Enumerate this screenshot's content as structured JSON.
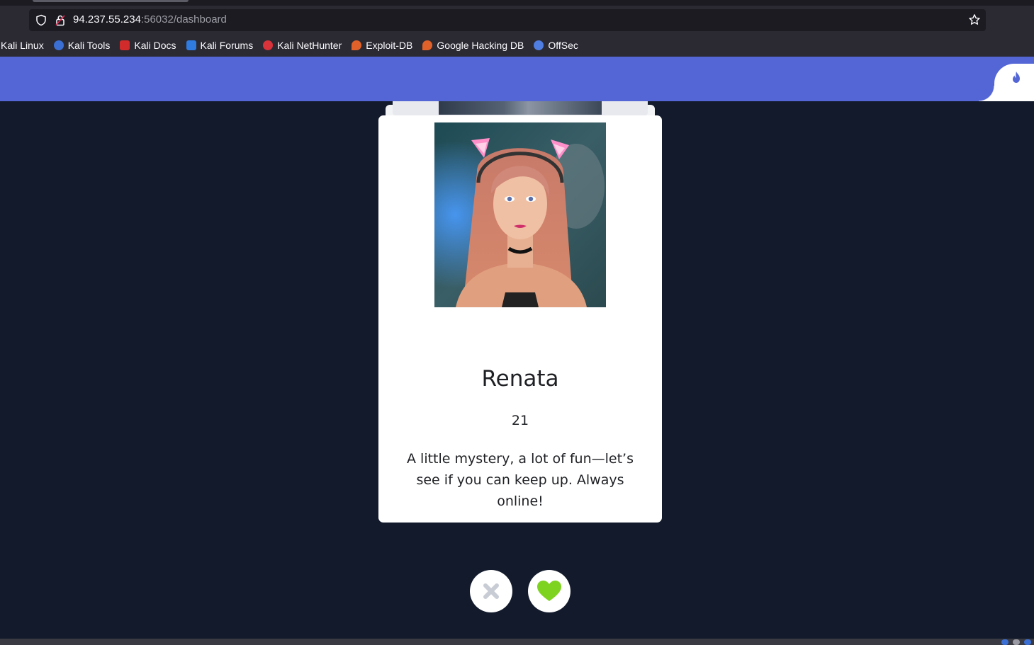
{
  "browser": {
    "url_host": "94.237.55.234",
    "url_rest": ":56032/dashboard",
    "bookmarks": [
      {
        "label": "Kali Linux",
        "icon": "kali-icon",
        "color": ""
      },
      {
        "label": "Kali Tools",
        "icon": "kali-tools-icon",
        "color": "#3b6fd4"
      },
      {
        "label": "Kali Docs",
        "icon": "kali-docs-icon",
        "color": "#d12b2b"
      },
      {
        "label": "Kali Forums",
        "icon": "kali-forums-icon",
        "color": "#2f7be0"
      },
      {
        "label": "Kali NetHunter",
        "icon": "nethunter-icon",
        "color": "#d8323a"
      },
      {
        "label": "Exploit-DB",
        "icon": "exploit-db-icon",
        "color": "#e0622a"
      },
      {
        "label": "Google Hacking DB",
        "icon": "ghdb-icon",
        "color": "#e0622a"
      },
      {
        "label": "OffSec",
        "icon": "offsec-icon",
        "color": "#4f7de0"
      }
    ]
  },
  "header": {
    "brand_icon": "flame-icon",
    "accent": "#5466d6"
  },
  "profile": {
    "name": "Renata",
    "age": "21",
    "bio": "A little mystery, a lot of fun—let’s see if you can keep up. Always online!"
  },
  "actions": {
    "nope_icon": "close-icon",
    "like_icon": "heart-icon",
    "like_color": "#7ed321",
    "nope_color": "#c8ccd4"
  }
}
